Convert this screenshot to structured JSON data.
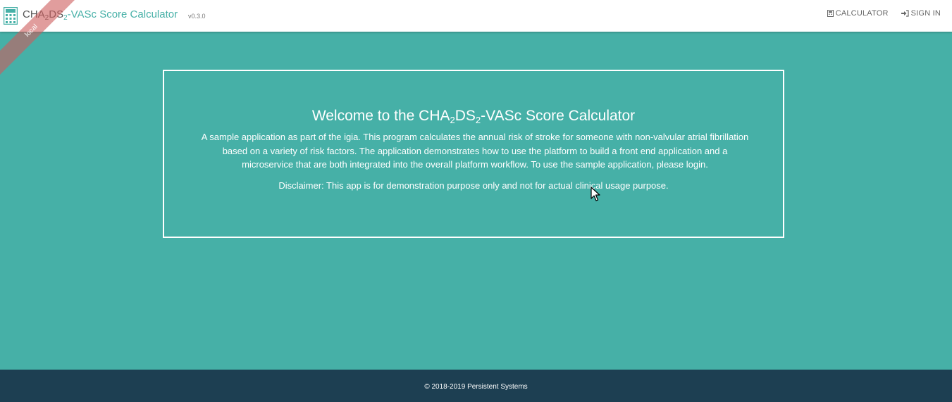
{
  "navbar": {
    "brand": {
      "part1": "CHA",
      "sub1": "2",
      "part2": "DS",
      "sub2": "2",
      "part3": "-VASc Score Calculator",
      "icon": "calculator-icon"
    },
    "version": "v0.3.0",
    "ribbon": "local",
    "links": {
      "calculator": "CALCULATOR",
      "calculator_icon": "calculator-icon",
      "sign_in": "SIGN IN",
      "sign_in_icon": "sign-in-icon"
    }
  },
  "welcome": {
    "title_part1": "Welcome to the CHA",
    "title_sub1": "2",
    "title_part2": "DS",
    "title_sub2": "2",
    "title_part3": "-VASc Score Calculator",
    "description": "A sample application as part of the igia. This program calculates the annual risk of stroke for someone with non-valvular atrial fibrillation based on a variety of risk factors. The application demonstrates how to use the platform to build a front end application and a microservice that are both integrated into the overall platform workflow. To use the sample application, please login.",
    "disclaimer": "Disclaimer: This app is for demonstration purpose only and not for actual clinical usage purpose."
  },
  "footer": {
    "copyright": "© 2018-2019 Persistent Systems"
  },
  "colors": {
    "background": "#46b0a7",
    "navbar": "#ffffff",
    "footer": "#1d3f52",
    "accent": "#46b0a7"
  }
}
